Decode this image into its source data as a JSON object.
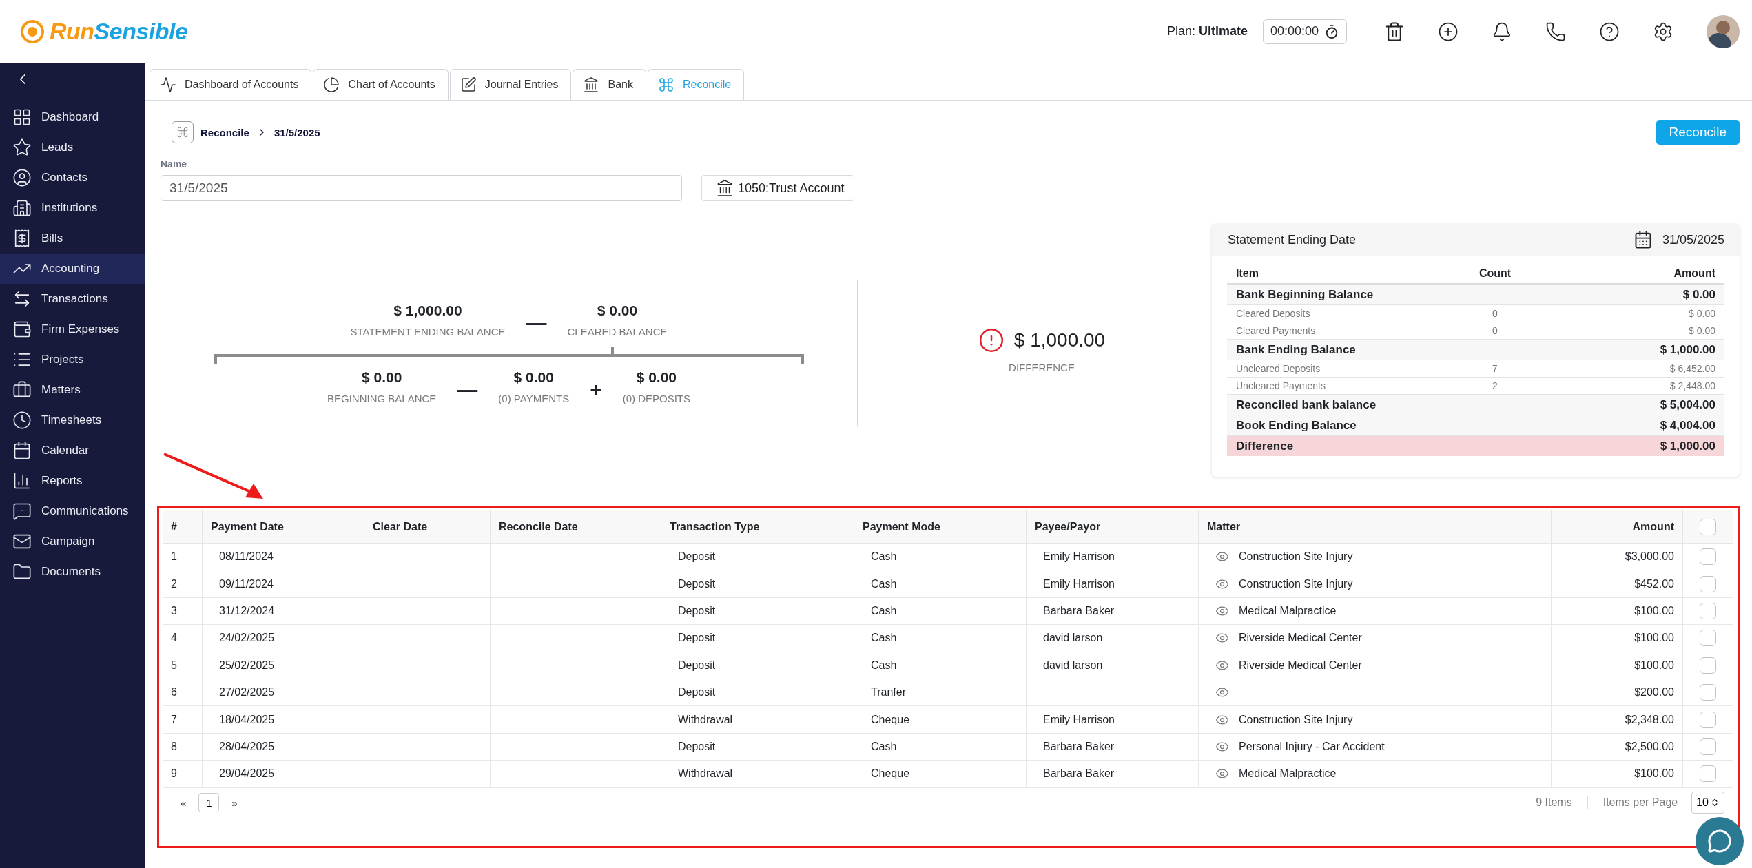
{
  "header": {
    "logo": {
      "part_a": "Run",
      "part_b": "Sensible"
    },
    "plan": "Plan: **Ultimate**",
    "timer": "00:00:00"
  },
  "sidebar": {
    "items": [
      {
        "label": "Dashboard",
        "selected": false
      },
      {
        "label": "Leads",
        "selected": false
      },
      {
        "label": "Contacts",
        "selected": false
      },
      {
        "label": "Institutions",
        "selected": false
      },
      {
        "label": "Bills",
        "selected": false
      },
      {
        "label": "Accounting",
        "selected": true
      },
      {
        "label": "Transactions",
        "selected": false
      },
      {
        "label": "Firm Expenses",
        "selected": false
      },
      {
        "label": "Projects",
        "selected": false
      },
      {
        "label": "Matters",
        "selected": false
      },
      {
        "label": "Timesheets",
        "selected": false
      },
      {
        "label": "Calendar",
        "selected": false
      },
      {
        "label": "Reports",
        "selected": false
      },
      {
        "label": "Communications",
        "selected": false
      },
      {
        "label": "Campaign",
        "selected": false
      },
      {
        "label": "Documents",
        "selected": false
      }
    ]
  },
  "tabs": [
    {
      "label": "Dashboard of Accounts",
      "selected": false
    },
    {
      "label": "Chart of Accounts",
      "selected": false
    },
    {
      "label": "Journal Entries",
      "selected": false
    },
    {
      "label": "Bank",
      "selected": false
    },
    {
      "label": "Reconcile",
      "selected": true
    }
  ],
  "breadcrumb": {
    "root": "Reconcile",
    "current": "31/5/2025"
  },
  "reconcile_button": "Reconcile",
  "name_field": {
    "label": "Name",
    "value": "31/5/2025"
  },
  "account_button": "1050:Trust Account",
  "formula": {
    "top": [
      {
        "kind": "value",
        "amount": "$ 1,000.00",
        "label": "STATEMENT ENDING BALANCE"
      },
      {
        "kind": "operator",
        "symbol": "—"
      },
      {
        "kind": "value",
        "amount": "$ 0.00",
        "label": "CLEARED BALANCE"
      }
    ],
    "bottom": [
      {
        "kind": "value",
        "amount": "$ 0.00",
        "label": "BEGINNING BALANCE"
      },
      {
        "kind": "operator",
        "symbol": "—"
      },
      {
        "kind": "value",
        "amount": "$ 0.00",
        "label": "(0) PAYMENTS"
      },
      {
        "kind": "operator",
        "symbol": "+"
      },
      {
        "kind": "value",
        "amount": "$ 0.00",
        "label": "(0) DEPOSITS"
      }
    ]
  },
  "difference": {
    "amount": "$ 1,000.00",
    "label": "DIFFERENCE"
  },
  "summary": {
    "title": "Statement Ending Date",
    "date": "31/05/2025",
    "columns": [
      "Item",
      "Count",
      "Amount"
    ],
    "rows": [
      {
        "kind": "total",
        "item": "Bank Beginning Balance",
        "amount": "$ 0.00"
      },
      {
        "kind": "detail",
        "item": "Cleared Deposits",
        "count": "0",
        "amount": "$ 0.00"
      },
      {
        "kind": "detail",
        "item": "Cleared Payments",
        "count": "0",
        "amount": "$ 0.00"
      },
      {
        "kind": "total",
        "item": "Bank Ending Balance",
        "amount": "$ 1,000.00"
      },
      {
        "kind": "detail",
        "item": "Uncleared Deposits",
        "count": "7",
        "amount": "$ 6,452.00"
      },
      {
        "kind": "detail",
        "item": "Uncleared Payments",
        "count": "2",
        "amount": "$ 2,448.00"
      },
      {
        "kind": "total",
        "item": "Reconciled bank balance",
        "amount": "$ 5,004.00"
      },
      {
        "kind": "total",
        "item": "Book Ending Balance",
        "amount": "$ 4,004.00"
      },
      {
        "kind": "difference",
        "item": "Difference",
        "amount": "$ 1,000.00"
      }
    ]
  },
  "table": {
    "columns": [
      "#",
      "Payment Date",
      "Clear Date",
      "Reconcile Date",
      "Transaction Type",
      "Payment Mode",
      "Payee/Payor",
      "Matter",
      "Amount"
    ],
    "all_checked": false,
    "rows": [
      {
        "no": "1",
        "payment_date": "08/11/2024",
        "type": "Deposit",
        "mode": "Cash",
        "payee": "Emily Harrison",
        "matter": "Construction Site Injury",
        "amount": "$3,000.00",
        "checked": false
      },
      {
        "no": "2",
        "payment_date": "09/11/2024",
        "type": "Deposit",
        "mode": "Cash",
        "payee": "Emily Harrison",
        "matter": "Construction Site Injury",
        "amount": "$452.00",
        "checked": false
      },
      {
        "no": "3",
        "payment_date": "31/12/2024",
        "type": "Deposit",
        "mode": "Cash",
        "payee": "Barbara Baker",
        "matter": "Medical Malpractice",
        "amount": "$100.00",
        "checked": false
      },
      {
        "no": "4",
        "payment_date": "24/02/2025",
        "type": "Deposit",
        "mode": "Cash",
        "payee": "david larson",
        "matter": "Riverside Medical Center",
        "amount": "$100.00",
        "checked": false
      },
      {
        "no": "5",
        "payment_date": "25/02/2025",
        "type": "Deposit",
        "mode": "Cash",
        "payee": "david larson",
        "matter": "Riverside Medical Center",
        "amount": "$100.00",
        "checked": false
      },
      {
        "no": "6",
        "payment_date": "27/02/2025",
        "type": "Deposit",
        "mode": "Tranfer",
        "amount": "$200.00",
        "checked": false
      },
      {
        "no": "7",
        "payment_date": "18/04/2025",
        "type": "Withdrawal",
        "mode": "Cheque",
        "payee": "Emily Harrison",
        "matter": "Construction Site Injury",
        "amount": "$2,348.00",
        "checked": false
      },
      {
        "no": "8",
        "payment_date": "28/04/2025",
        "type": "Deposit",
        "mode": "Cash",
        "payee": "Barbara Baker",
        "matter": "Personal Injury - Car Accident",
        "amount": "$2,500.00",
        "checked": false
      },
      {
        "no": "9",
        "payment_date": "29/04/2025",
        "type": "Withdrawal",
        "mode": "Cheque",
        "payee": "Barbara Baker",
        "matter": "Medical Malpractice",
        "amount": "$100.00",
        "checked": false
      }
    ]
  },
  "pagination": {
    "prev": "«",
    "page": "1",
    "next": "»",
    "count": "9 Items",
    "per_page_label": "Items per Page",
    "per_page": "10"
  }
}
